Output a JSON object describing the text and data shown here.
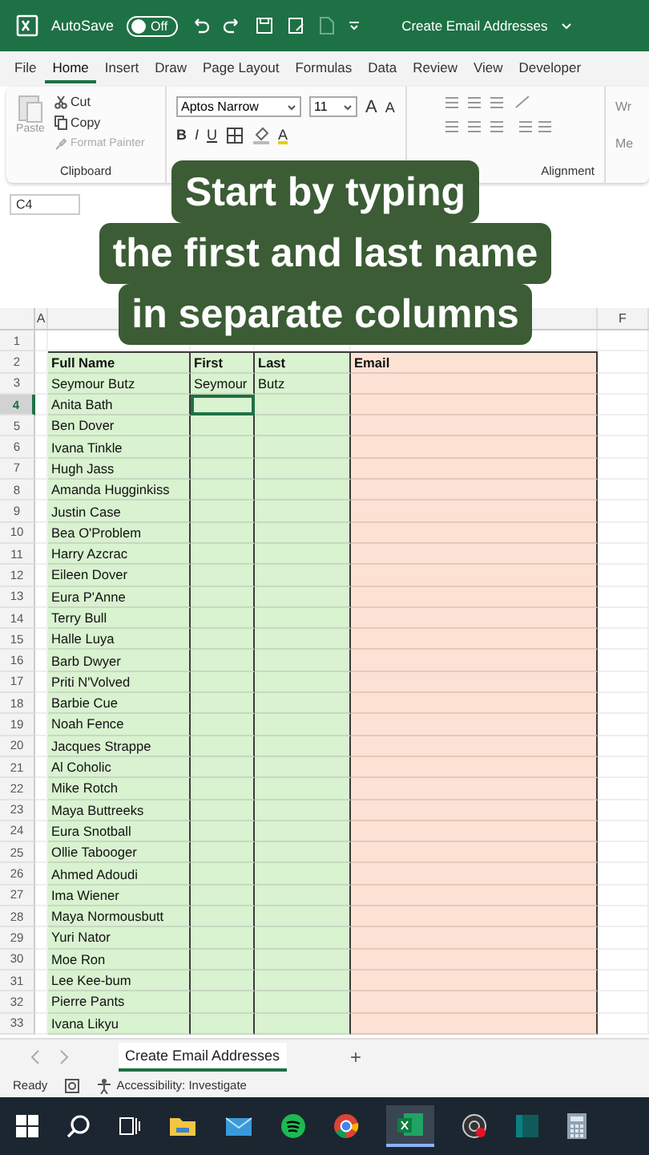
{
  "title_bar": {
    "autosave_label": "AutoSave",
    "autosave_on": false,
    "toggle_text": "Off",
    "document_title": "Create Email Addresses"
  },
  "ribbon_tabs": [
    {
      "label": "File",
      "selected": false
    },
    {
      "label": "Home",
      "selected": true
    },
    {
      "label": "Insert",
      "selected": false
    },
    {
      "label": "Draw",
      "selected": false
    },
    {
      "label": "Page Layout",
      "selected": false
    },
    {
      "label": "Formulas",
      "selected": false
    },
    {
      "label": "Data",
      "selected": false
    },
    {
      "label": "Review",
      "selected": false
    },
    {
      "label": "View",
      "selected": false
    },
    {
      "label": "Developer",
      "selected": false
    }
  ],
  "ribbon": {
    "clipboard": {
      "paste": "Paste",
      "cut": "Cut",
      "copy": "Copy",
      "format_painter": "Format Painter",
      "label": "Clipboard"
    },
    "font": {
      "name": "Aptos Narrow",
      "size": "11",
      "grow": "A",
      "shrink": "A",
      "bold": "B",
      "italic": "I",
      "underline": "U",
      "font_color": "A"
    },
    "alignment": {
      "label": "Alignment"
    },
    "cut_off": [
      "Wr",
      "Me"
    ]
  },
  "name_box": "C4",
  "caption_lines": [
    "Start by typing",
    "the first and last name",
    "in separate columns"
  ],
  "column_headers": [
    {
      "label": "A"
    },
    {
      "label": "F"
    }
  ],
  "grid": {
    "blank_row": "1",
    "header": {
      "num": "2",
      "cells": [
        "Full Name",
        "First",
        "Last",
        "Email"
      ]
    },
    "rows": [
      {
        "num": "3",
        "full_name": "Seymour Butz",
        "first": "Seymour",
        "last": "Butz",
        "selected": false
      },
      {
        "num": "4",
        "full_name": "Anita Bath",
        "selected": true
      },
      {
        "num": "5",
        "full_name": "Ben Dover",
        "selected": false
      },
      {
        "num": "6",
        "full_name": "Ivana Tinkle",
        "selected": false
      },
      {
        "num": "7",
        "full_name": "Hugh Jass",
        "selected": false
      },
      {
        "num": "8",
        "full_name": "Amanda Hugginkiss",
        "selected": false
      },
      {
        "num": "9",
        "full_name": "Justin Case",
        "selected": false
      },
      {
        "num": "10",
        "full_name": "Bea O'Problem",
        "selected": false
      },
      {
        "num": "11",
        "full_name": "Harry Azcrac",
        "selected": false
      },
      {
        "num": "12",
        "full_name": "Eileen Dover",
        "selected": false
      },
      {
        "num": "13",
        "full_name": "Eura P'Anne",
        "selected": false
      },
      {
        "num": "14",
        "full_name": "Terry Bull",
        "selected": false
      },
      {
        "num": "15",
        "full_name": "Halle Luya",
        "selected": false
      },
      {
        "num": "16",
        "full_name": "Barb Dwyer",
        "selected": false
      },
      {
        "num": "17",
        "full_name": "Priti N'Volved",
        "selected": false
      },
      {
        "num": "18",
        "full_name": "Barbie Cue",
        "selected": false
      },
      {
        "num": "19",
        "full_name": "Noah Fence",
        "selected": false
      },
      {
        "num": "20",
        "full_name": "Jacques Strappe",
        "selected": false
      },
      {
        "num": "21",
        "full_name": "Al Coholic",
        "selected": false
      },
      {
        "num": "22",
        "full_name": "Mike Rotch",
        "selected": false
      },
      {
        "num": "23",
        "full_name": "Maya Buttreeks",
        "selected": false
      },
      {
        "num": "24",
        "full_name": "Eura Snotball",
        "selected": false
      },
      {
        "num": "25",
        "full_name": "Ollie Tabooger",
        "selected": false
      },
      {
        "num": "26",
        "full_name": "Ahmed Adoudi",
        "selected": false
      },
      {
        "num": "27",
        "full_name": "Ima Wiener",
        "selected": false
      },
      {
        "num": "28",
        "full_name": "Maya Normousbutt",
        "selected": false
      },
      {
        "num": "29",
        "full_name": "Yuri Nator",
        "selected": false
      },
      {
        "num": "30",
        "full_name": "Moe Ron",
        "selected": false
      },
      {
        "num": "31",
        "full_name": "Lee Kee-bum",
        "selected": false
      },
      {
        "num": "32",
        "full_name": "Pierre Pants",
        "selected": false
      },
      {
        "num": "33",
        "full_name": "Ivana Likyu",
        "selected": false
      }
    ]
  },
  "sheet_tabs": [
    {
      "label": "Create Email Addresses",
      "selected": true
    }
  ],
  "add_sheet": "+",
  "status_bar": {
    "ready": "Ready",
    "accessibility": "Accessibility: Investigate"
  }
}
